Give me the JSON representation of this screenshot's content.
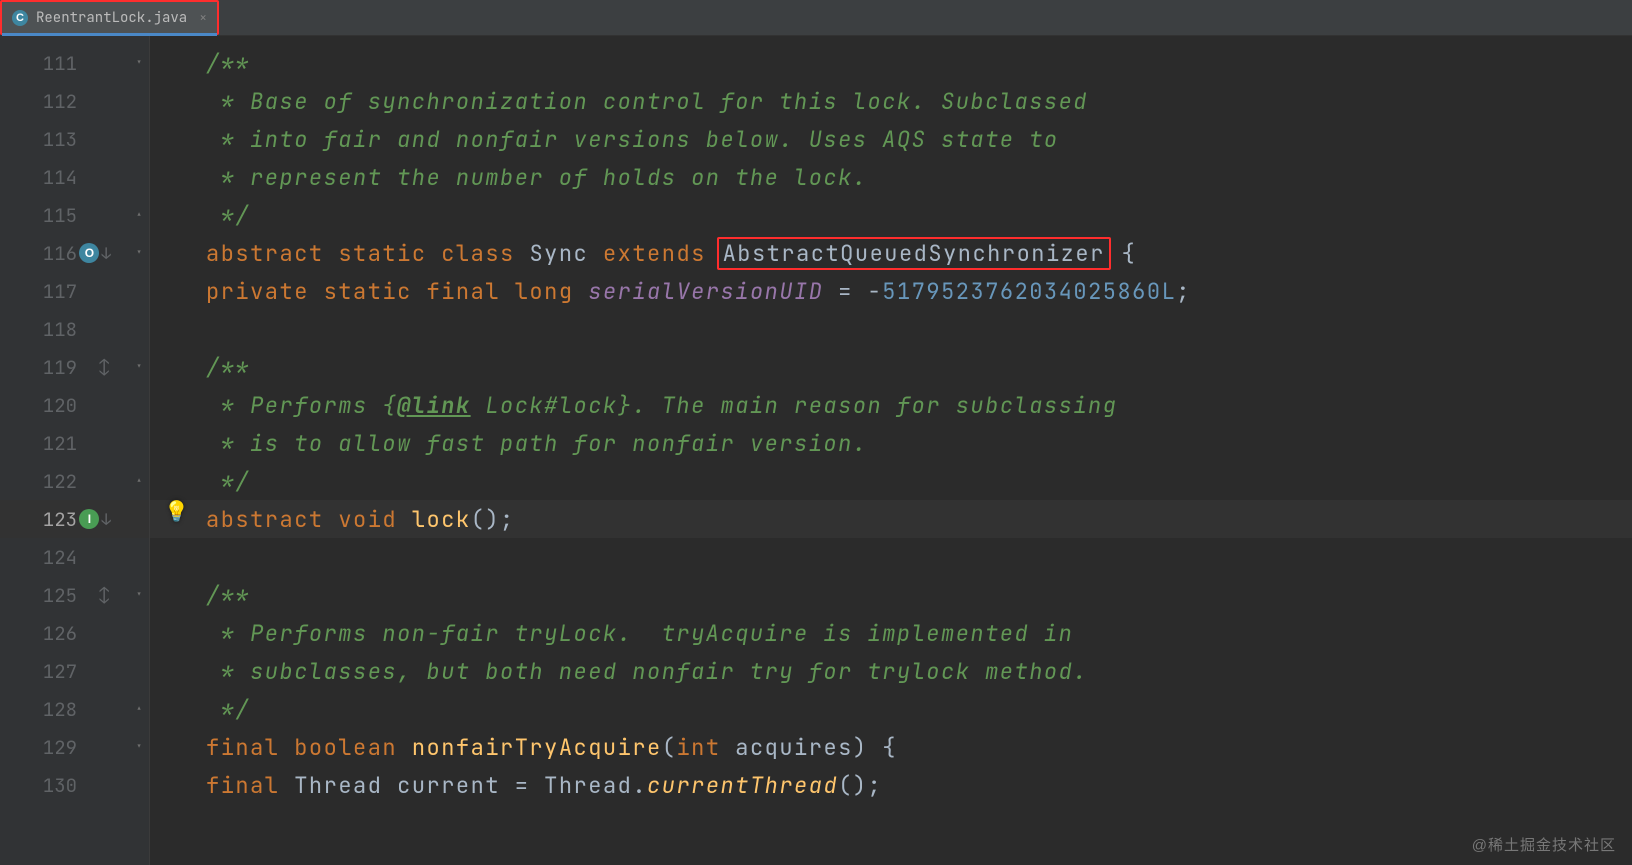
{
  "tab": {
    "icon_letter": "C",
    "filename": "ReentrantLock.java",
    "close": "×"
  },
  "watermark": "@稀土掘金技术社区",
  "lines": [
    {
      "num": 111,
      "indent": "        ",
      "fold": "down",
      "tokens": [
        [
          "doc",
          "/**"
        ]
      ]
    },
    {
      "num": 112,
      "indent": "        ",
      "tokens": [
        [
          "doc",
          " * Base of synchronization control for this lock. Subclassed"
        ]
      ]
    },
    {
      "num": 113,
      "indent": "        ",
      "tokens": [
        [
          "doc",
          " * into fair and nonfair versions below. Uses AQS state to"
        ]
      ]
    },
    {
      "num": 114,
      "indent": "        ",
      "tokens": [
        [
          "doc",
          " * represent the number of holds on the lock."
        ]
      ]
    },
    {
      "num": 115,
      "indent": "        ",
      "fold": "up",
      "tokens": [
        [
          "doc",
          " */"
        ]
      ]
    },
    {
      "num": 116,
      "indent": "        ",
      "marker": "override",
      "fold": "down",
      "tokens": [
        [
          "kw",
          "abstract"
        ],
        [
          "punct",
          " "
        ],
        [
          "kw",
          "static"
        ],
        [
          "punct",
          " "
        ],
        [
          "kw",
          "class"
        ],
        [
          "punct",
          " "
        ],
        [
          "class",
          "Sync"
        ],
        [
          "punct",
          " "
        ],
        [
          "kw",
          "extends"
        ],
        [
          "punct",
          " "
        ],
        [
          "classRB",
          "AbstractQueuedSynchronizer"
        ],
        [
          "punct",
          " {"
        ]
      ]
    },
    {
      "num": 117,
      "indent": "            ",
      "tokens": [
        [
          "kw",
          "private"
        ],
        [
          "punct",
          " "
        ],
        [
          "kw",
          "static"
        ],
        [
          "punct",
          " "
        ],
        [
          "kw",
          "final"
        ],
        [
          "punct",
          " "
        ],
        [
          "kw",
          "long"
        ],
        [
          "punct",
          " "
        ],
        [
          "field",
          "serialVersionUID"
        ],
        [
          "punct",
          " = -"
        ],
        [
          "num",
          "5179523762034025860L"
        ],
        [
          "punct",
          ";"
        ]
      ]
    },
    {
      "num": 118,
      "indent": "",
      "tokens": []
    },
    {
      "num": 119,
      "indent": "            ",
      "expand": true,
      "fold": "down",
      "tokens": [
        [
          "doc",
          "/**"
        ]
      ]
    },
    {
      "num": 120,
      "indent": "            ",
      "tokens": [
        [
          "doc",
          " * Performs {"
        ],
        [
          "doctag",
          "@link"
        ],
        [
          "doc",
          " Lock#lock}. The main reason for subclassing"
        ]
      ]
    },
    {
      "num": 121,
      "indent": "            ",
      "tokens": [
        [
          "doc",
          " * is to allow fast path for nonfair version."
        ]
      ]
    },
    {
      "num": 122,
      "indent": "            ",
      "fold": "up",
      "tokens": [
        [
          "doc",
          " */"
        ]
      ]
    },
    {
      "num": 123,
      "indent": "            ",
      "marker": "impl",
      "bulb": true,
      "current": true,
      "tokens": [
        [
          "kw",
          "abstract"
        ],
        [
          "punct",
          " "
        ],
        [
          "kw",
          "void"
        ],
        [
          "punct",
          " "
        ],
        [
          "method",
          "lock"
        ],
        [
          "punct",
          "();"
        ]
      ]
    },
    {
      "num": 124,
      "indent": "",
      "tokens": []
    },
    {
      "num": 125,
      "indent": "            ",
      "expand": true,
      "fold": "down",
      "tokens": [
        [
          "doc",
          "/**"
        ]
      ]
    },
    {
      "num": 126,
      "indent": "            ",
      "tokens": [
        [
          "doc",
          " * Performs non-fair tryLock.  tryAcquire is implemented in"
        ]
      ]
    },
    {
      "num": 127,
      "indent": "            ",
      "tokens": [
        [
          "doc",
          " * subclasses, but both need nonfair try for trylock method."
        ]
      ]
    },
    {
      "num": 128,
      "indent": "            ",
      "fold": "up",
      "tokens": [
        [
          "doc",
          " */"
        ]
      ]
    },
    {
      "num": 129,
      "indent": "            ",
      "fold": "down",
      "tokens": [
        [
          "kw",
          "final"
        ],
        [
          "punct",
          " "
        ],
        [
          "kw",
          "boolean"
        ],
        [
          "punct",
          " "
        ],
        [
          "method",
          "nonfairTryAcquire"
        ],
        [
          "punct",
          "("
        ],
        [
          "kw",
          "int"
        ],
        [
          "punct",
          " "
        ],
        [
          "param",
          "acquires"
        ],
        [
          "punct",
          ") {"
        ]
      ]
    },
    {
      "num": 130,
      "indent": "                ",
      "tokens": [
        [
          "kw",
          "final"
        ],
        [
          "punct",
          " "
        ],
        [
          "class",
          "Thread"
        ],
        [
          "punct",
          " "
        ],
        [
          "ident",
          "current"
        ],
        [
          "punct",
          " = "
        ],
        [
          "class",
          "Thread"
        ],
        [
          "punct",
          "."
        ],
        [
          "methodI",
          "currentThread"
        ],
        [
          "punct",
          "();"
        ]
      ]
    }
  ]
}
